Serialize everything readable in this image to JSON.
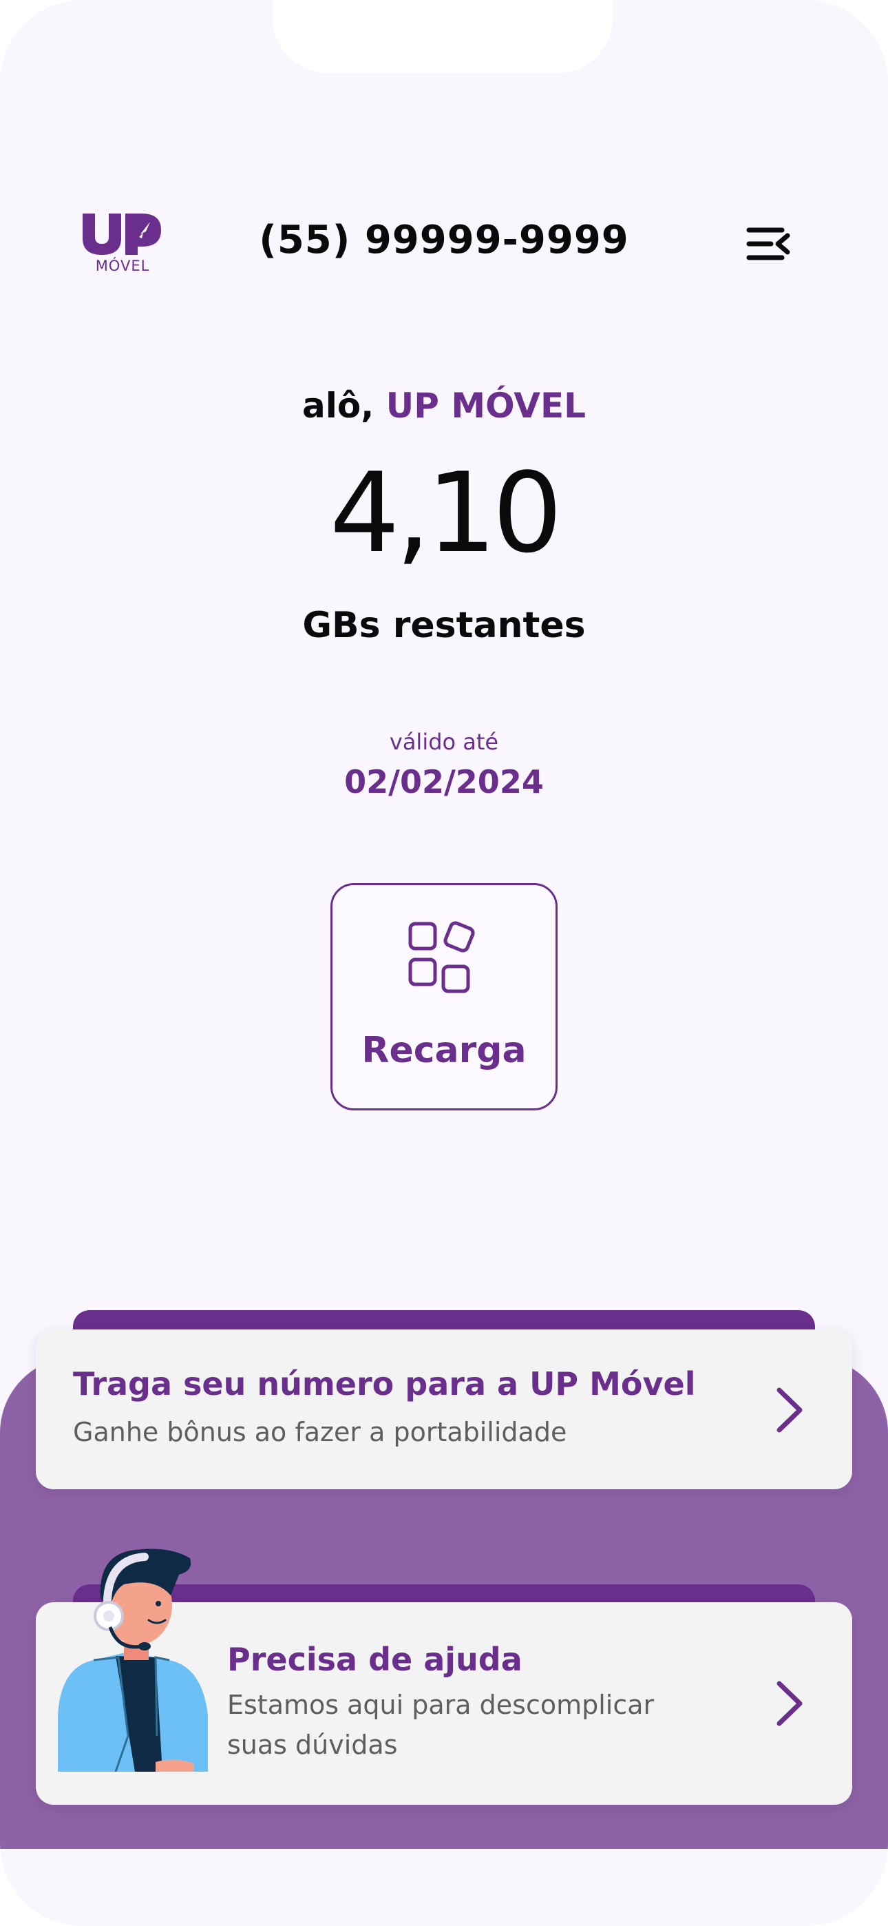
{
  "header": {
    "logo_mark": "UP",
    "logo_sub": "MÓVEL",
    "phone_number": "(55) 99999-9999",
    "menu_icon": "menu-collapse-icon"
  },
  "hero": {
    "greeting_prefix": "alô,",
    "greeting_name": "UP MÓVEL",
    "balance": "4,10",
    "balance_label": "GBs restantes",
    "valid_label": "válido até",
    "valid_date": "02/02/2024"
  },
  "recharge": {
    "label": "Recarga",
    "icon": "apps-grid-icon"
  },
  "cards": [
    {
      "title": "Traga seu número para a UP Móvel",
      "subtitle": "Ganhe bônus ao fazer a portabilidade",
      "icon": "chevron-right-icon"
    },
    {
      "title": "Precisa de ajuda",
      "subtitle_line1": "Estamos aqui para descomplicar",
      "subtitle_line2": "suas dúvidas",
      "icon": "chevron-right-icon",
      "illustration": "support-agent-illustration"
    }
  ],
  "colors": {
    "brand": "#6a2e8c",
    "panel": "#8e62a6",
    "background": "#f9f6fd",
    "card": "#f3f3f3"
  }
}
